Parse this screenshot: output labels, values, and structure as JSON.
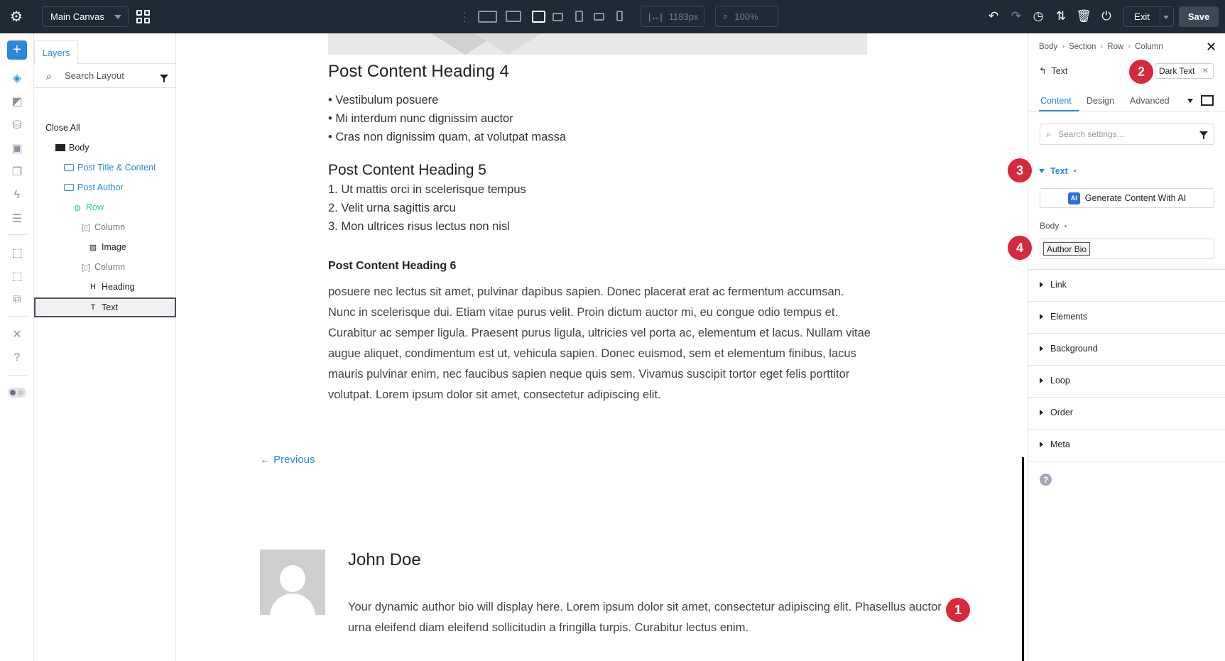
{
  "topbar": {
    "canvas_select": "Main Canvas",
    "width_readout": "1183px",
    "zoom_readout": "100%",
    "exit_label": "Exit",
    "save_label": "Save"
  },
  "layers": {
    "tab_label": "Layers",
    "search_placeholder": "Search Layout",
    "close_all": "Close All",
    "items": [
      {
        "label": "Body",
        "icon": "section-icon",
        "color": "#222222"
      },
      {
        "label": "Post Title & Content",
        "icon": "module-icon",
        "color": "#2b87da"
      },
      {
        "label": "Post Author",
        "icon": "module-icon",
        "color": "#2b87da"
      },
      {
        "label": "Row",
        "icon": "row-icon",
        "color": "#29c4a9"
      },
      {
        "label": "Column",
        "icon": "column-icon",
        "color": "#7a7a7a"
      },
      {
        "label": "Image",
        "icon": "image-icon",
        "color": "#222222"
      },
      {
        "label": "Column",
        "icon": "column-icon",
        "color": "#7a7a7a"
      },
      {
        "label": "Heading",
        "icon": "heading-icon",
        "color": "#222222"
      },
      {
        "label": "Text",
        "icon": "text-icon",
        "color": "#222222"
      }
    ]
  },
  "canvas": {
    "heading4": "Post Content Heading 4",
    "bullets": [
      "Vestibulum posuere",
      "Mi interdum nunc dignissim auctor",
      "Cras non dignissim quam, at volutpat massa"
    ],
    "heading5": "Post Content Heading 5",
    "numbered": [
      "1. Ut mattis orci in scelerisque tempus",
      "2. Velit urna sagittis arcu",
      "3. Mon ultrices risus lectus non nisl"
    ],
    "heading6": "Post Content Heading 6",
    "paragraph": "posuere nec lectus sit amet, pulvinar dapibus sapien. Donec placerat erat ac fermentum accumsan. Nunc in scelerisque dui. Etiam vitae purus velit. Proin dictum auctor mi, eu congue odio tempus et. Curabitur ac semper ligula. Praesent purus ligula, ultricies vel porta ac, elementum et lacus. Nullam vitae augue aliquet, condimentum est ut, vehicula sapien. Donec euismod, sem et elementum finibus, lacus mauris pulvinar enim, nec faucibus sapien neque quis sem. Vivamus suscipit tortor eget felis porttitor volutpat. Lorem ipsum dolor sit amet, consectetur adipiscing elit.",
    "prev_link": "← Previous",
    "author_name": "John Doe",
    "author_bio": "Your dynamic author bio will display here. Lorem ipsum dolor sit amet, consectetur adipiscing elit. Phasellus auctor urna eleifend diam eleifend sollicitudin a fringilla turpis. Curabitur lectus enim."
  },
  "badges": [
    "1",
    "2",
    "3",
    "4"
  ],
  "settings": {
    "breadcrumb": [
      "Body",
      "Section",
      "Row",
      "Column"
    ],
    "module_title": "Text",
    "preset_tag": "Dark Text",
    "tabs": [
      "Content",
      "Design",
      "Advanced"
    ],
    "search_placeholder": "Search settings...",
    "open_section": "Text",
    "ai_button": "Generate Content With AI",
    "ai_chip": "AI",
    "body_label": "Body",
    "body_value": "Author Bio",
    "sections": [
      "Link",
      "Elements",
      "Background",
      "Loop",
      "Order",
      "Meta"
    ]
  },
  "colors": {
    "topbar_bg": "#1f2a37",
    "accent": "#2b87da",
    "badge": "#d6293b",
    "row_green": "#29c4a9"
  }
}
